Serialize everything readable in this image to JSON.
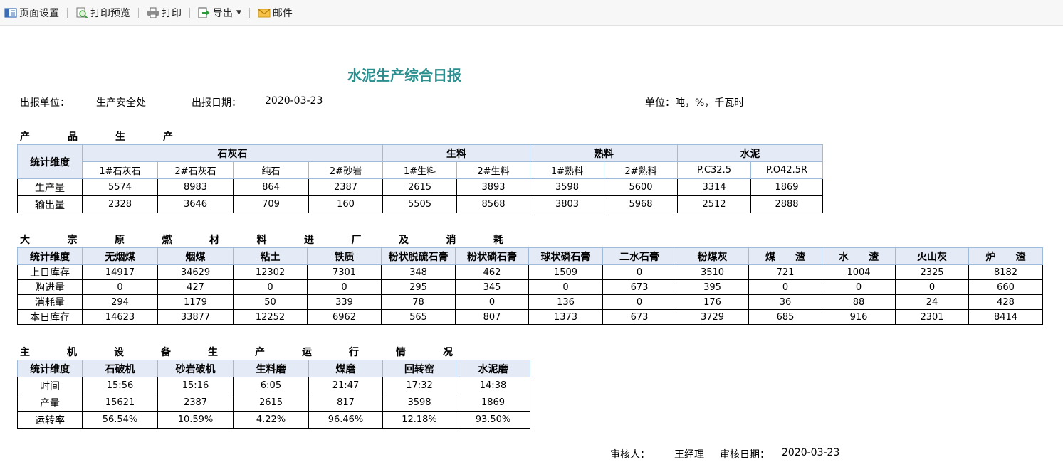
{
  "toolbar": {
    "page_setup": "页面设置",
    "print_preview": "打印预览",
    "print": "打印",
    "export": "导出",
    "mail": "邮件"
  },
  "report": {
    "title": "水泥生产综合日报",
    "unit_label": "出报单位：",
    "unit_value": "生产安全处",
    "date_label": "出报日期：",
    "date_value": "2020-03-23",
    "units_note": "单位：吨，%，千瓦时"
  },
  "product": {
    "section_title": [
      "产",
      "品",
      "生",
      "产"
    ],
    "dim_header": "统计维度",
    "groups": [
      {
        "name": "石灰石",
        "subs": [
          "1#石灰石",
          "2#石灰石",
          "纯石",
          "2#砂岩"
        ]
      },
      {
        "name": "生料",
        "subs": [
          "1#生料",
          "2#生料"
        ]
      },
      {
        "name": "熟料",
        "subs": [
          "1#熟料",
          "2#熟料"
        ]
      },
      {
        "name": "水泥",
        "subs": [
          "P.C32.5",
          "P.O42.5R"
        ]
      }
    ],
    "rows": [
      {
        "label": "生产量",
        "values": [
          "5574",
          "8983",
          "864",
          "2387",
          "2615",
          "3893",
          "3598",
          "5600",
          "3314",
          "1869"
        ]
      },
      {
        "label": "输出量",
        "values": [
          "2328",
          "3646",
          "709",
          "160",
          "5505",
          "8568",
          "3803",
          "5968",
          "2512",
          "2888"
        ]
      }
    ]
  },
  "materials": {
    "section_title": [
      "大",
      "宗",
      "原",
      "燃",
      "材",
      "料",
      "进",
      "厂",
      "及",
      "消",
      "耗"
    ],
    "dim_header": "统计维度",
    "headers": [
      "无烟煤",
      "烟煤",
      "粘土",
      "铁质",
      "粉状脱硫石膏",
      "粉状磷石膏",
      "球状磷石膏",
      "二水石膏",
      "粉煤灰",
      "煤　　渣",
      "水　　渣",
      "火山灰",
      "炉　　渣"
    ],
    "rows": [
      {
        "label": "上日库存",
        "values": [
          "14917",
          "34629",
          "12302",
          "7301",
          "348",
          "462",
          "1509",
          "0",
          "3510",
          "721",
          "1004",
          "2325",
          "8182"
        ]
      },
      {
        "label": "购进量",
        "values": [
          "0",
          "427",
          "0",
          "0",
          "295",
          "345",
          "0",
          "673",
          "395",
          "0",
          "0",
          "0",
          "660"
        ]
      },
      {
        "label": "消耗量",
        "values": [
          "294",
          "1179",
          "50",
          "339",
          "78",
          "0",
          "136",
          "0",
          "176",
          "36",
          "88",
          "24",
          "428"
        ]
      },
      {
        "label": "本日库存",
        "values": [
          "14623",
          "33877",
          "12252",
          "6962",
          "565",
          "807",
          "1373",
          "673",
          "3729",
          "685",
          "916",
          "2301",
          "8414"
        ]
      }
    ]
  },
  "equipment": {
    "section_title": [
      "主",
      "机",
      "设",
      "备",
      "生",
      "产",
      "运",
      "行",
      "情",
      "况"
    ],
    "dim_header": "统计维度",
    "headers": [
      "石破机",
      "砂岩破机",
      "生料磨",
      "煤磨",
      "回转窑",
      "水泥磨"
    ],
    "rows": [
      {
        "label": "时间",
        "values": [
          "15:56",
          "15:16",
          "6:05",
          "21:47",
          "17:32",
          "14:38"
        ]
      },
      {
        "label": "产量",
        "values": [
          "15621",
          "2387",
          "2615",
          "817",
          "3598",
          "1869"
        ]
      },
      {
        "label": "运转率",
        "values": [
          "56.54%",
          "10.59%",
          "4.22%",
          "96.46%",
          "12.18%",
          "93.50%"
        ]
      }
    ]
  },
  "footer": {
    "reviewer_label": "审核人：",
    "reviewer_value": "王经理",
    "review_date_label": "审核日期：",
    "review_date_value": "2020-03-23"
  },
  "icons": {
    "page_setup": "page-setup-icon",
    "print_preview": "magnifier-preview-icon",
    "print": "printer-icon",
    "export": "export-arrow-icon",
    "mail": "envelope-icon"
  },
  "colors": {
    "title": "#2a8e8e",
    "header_bg": "#e4eaf6",
    "header_border": "#9fbbdc"
  }
}
